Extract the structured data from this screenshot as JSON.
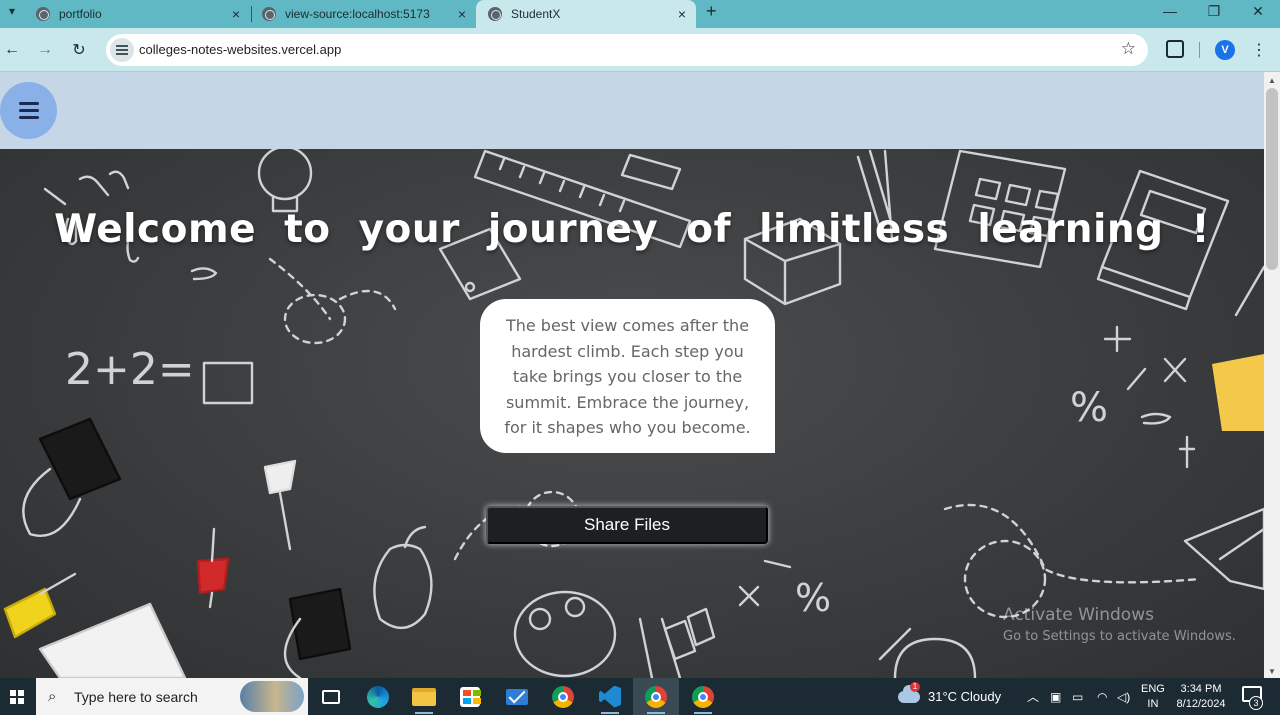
{
  "browser": {
    "tabs": [
      {
        "title": "portfolio",
        "close": "×"
      },
      {
        "title": "view-source:localhost:5173",
        "close": "×"
      },
      {
        "title": "StudentX",
        "close": "×",
        "active": true
      }
    ],
    "new_tab_glyph": "+",
    "window_controls": {
      "minimize": "—",
      "restore": "❐",
      "close": "✕"
    },
    "nav": {
      "back": "←",
      "forward": "→",
      "reload": "↻"
    },
    "url": "colleges-notes-websites.vercel.app",
    "bookmark_glyph": "☆",
    "profile_initial": "V",
    "menu_glyph": "⋮"
  },
  "page": {
    "headline": "Welcome to your journey of limitless learning !",
    "quote": "The best view comes after the hardest climb. Each step you take brings you closer to the summit. Embrace the journey, for it shapes who you become.",
    "cta_label": "Share Files",
    "doodle_math": "2+2=",
    "doodle_symbols": "%",
    "watermark": {
      "line1": "Activate Windows",
      "line2": "Go to Settings to activate Windows."
    },
    "colors": {
      "header_bg": "#c5d6e6",
      "menu_button": "#8ab0e8",
      "cta_bg": "#1e1f20"
    }
  },
  "taskbar": {
    "search_placeholder": "Type here to search",
    "weather": "31°C  Cloudy",
    "weather_badge": "1",
    "language": {
      "line1": "ENG",
      "line2": "IN"
    },
    "time": "3:34 PM",
    "date": "8/12/2024",
    "notifications_count": "3",
    "apps": [
      "task-view",
      "edge",
      "file-explorer",
      "microsoft-store",
      "mail",
      "chrome",
      "vscode",
      "chrome-profile-v",
      "chrome-profile-v-2"
    ]
  }
}
